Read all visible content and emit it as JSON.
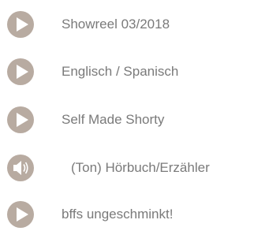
{
  "colors": {
    "icon_circle": "#b8aba1",
    "icon_glyph": "#ffffff",
    "label_text": "#7a7a7a"
  },
  "items": [
    {
      "label": "Showreel 03/2018",
      "icon": "play-icon"
    },
    {
      "label": "Englisch / Spanisch",
      "icon": "play-icon"
    },
    {
      "label": "Self Made Shorty",
      "icon": "play-icon"
    },
    {
      "label": "(Ton) Hörbuch/Erzähler",
      "icon": "speaker-icon"
    },
    {
      "label": "bffs ungeschminkt!",
      "icon": "play-icon"
    }
  ]
}
